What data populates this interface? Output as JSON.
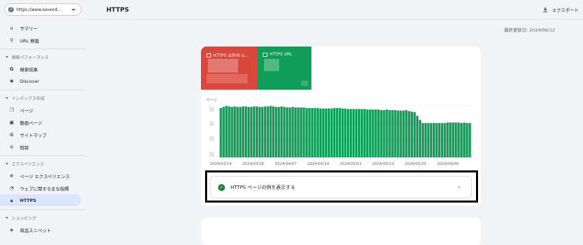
{
  "property": {
    "url": "https://www.sevend...",
    "logo": "7"
  },
  "sidebar": {
    "summary": "サマリー",
    "url_inspection": "URL 検査",
    "sec_performance": "検索パフォーマンス",
    "search_results": "検索結果",
    "discover": "Discover",
    "sec_index": "インデックス作成",
    "pages": "ページ",
    "video_pages": "動画ページ",
    "sitemaps": "サイトマップ",
    "removals": "削除",
    "sec_experience": "エクスペリエンス",
    "page_experience": "ページ エクスペリエンス",
    "core_web_vitals": "ウェブに関する主な指標",
    "https": "HTTPS",
    "sec_shopping": "ショッピング",
    "product_snippets": "商品スニペット"
  },
  "header": {
    "title": "HTTPS",
    "export_label": "エクスポート",
    "last_updated": "最終更新日: 2024/06/12"
  },
  "tiles": {
    "non_https_label": "HTTPS 以外の U...",
    "https_label": "HTTPS URL"
  },
  "chart_data": {
    "type": "bar",
    "ylabel": "ページ",
    "colors": {
      "bar": "#0f9d58",
      "grid": "#e8eaed"
    },
    "x_tick_labels": [
      "2024/03/14",
      "2024/03/26",
      "2024/04/07",
      "2024/04/19",
      "2024/05/01",
      "2024/05/13",
      "2024/05/25",
      "2024/06/06"
    ],
    "values": [
      0.95,
      0.97,
      0.99,
      0.98,
      0.97,
      0.98,
      0.97,
      0.97,
      0.98,
      0.98,
      0.97,
      0.97,
      0.98,
      0.98,
      0.97,
      0.97,
      0.98,
      0.98,
      0.99,
      0.98,
      0.97,
      0.97,
      0.98,
      0.97,
      0.96,
      0.96,
      0.97,
      0.96,
      0.96,
      0.96,
      0.96,
      0.95,
      0.95,
      0.95,
      0.95,
      0.95,
      0.94,
      0.94,
      0.94,
      0.94,
      0.94,
      0.95,
      0.95,
      0.95,
      0.94,
      0.94,
      0.93,
      0.93,
      0.93,
      0.93,
      0.93,
      0.93,
      0.93,
      0.92,
      0.92,
      0.92,
      0.92,
      0.92,
      0.91,
      0.91,
      0.92,
      0.91,
      0.91,
      0.91,
      0.9,
      0.9,
      0.9,
      0.91,
      0.89,
      0.88,
      0.87,
      0.8,
      0.72,
      0.66,
      0.66,
      0.66,
      0.66,
      0.66,
      0.66,
      0.66,
      0.66,
      0.66,
      0.67,
      0.67,
      0.67,
      0.67,
      0.67,
      0.66,
      0.67,
      0.66,
      0.66
    ]
  },
  "sample": {
    "label": "HTTPS ページの例を表示する"
  }
}
